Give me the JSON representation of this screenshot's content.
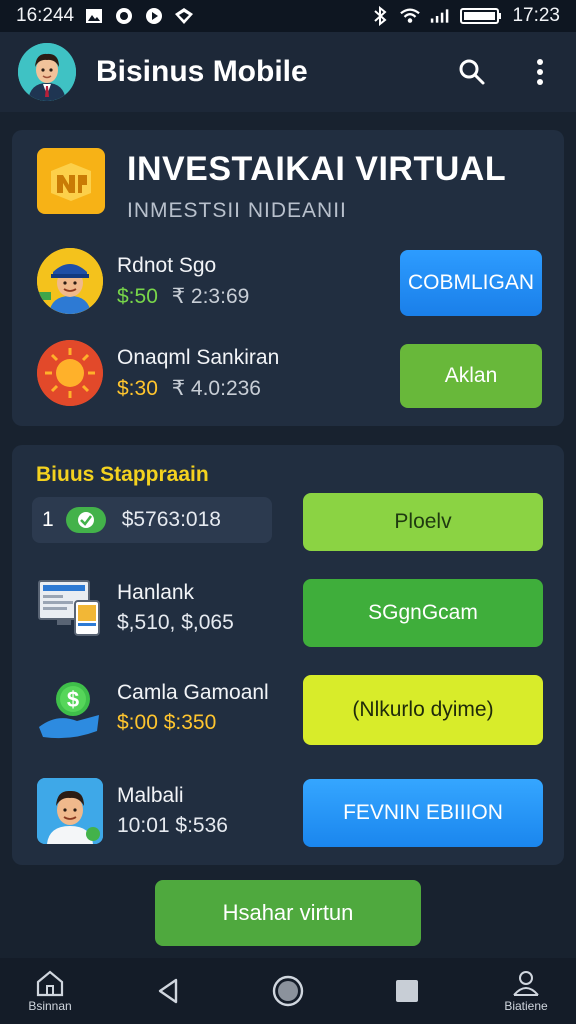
{
  "status_bar": {
    "time_left": "16:244",
    "time_right": "17:23",
    "icons": [
      "image-icon",
      "sync-icon",
      "play-icon",
      "shield-icon",
      "bluetooth-icon",
      "wifi-icon",
      "signal-icon",
      "battery-icon"
    ]
  },
  "app_bar": {
    "title": "Bisinus Mobile",
    "icons": [
      "search-icon",
      "more-vert-icon"
    ]
  },
  "invest_card": {
    "title": "INVESTAIKAI VIRTUAL",
    "subtitle": "INMESTSII NIDEANII",
    "rows": [
      {
        "name": "Rdnot Sgo",
        "value": "$:50",
        "extra": "₹ 2:3:69",
        "button": "COBMLIGAN"
      },
      {
        "name": "Onaqml Sankiran",
        "value": "$:30",
        "extra": "₹ 4.0:236",
        "button": "Aklan"
      }
    ]
  },
  "list_card": {
    "section_title": "Biuus Stappraain",
    "balance": {
      "index": "1",
      "value": "$5763:018"
    },
    "balance_button": "Ploelv",
    "rows": [
      {
        "name": "Hanlank",
        "values": "$,510, $,065",
        "button": "SGgnGcam"
      },
      {
        "name": "Camla Gamoanl",
        "values": "$:00  $:350",
        "button": "(Nlkurlo dyime)"
      },
      {
        "name": "Malbali",
        "values": "10:01 $:536",
        "button": "FEVNIN EBIIION"
      }
    ]
  },
  "bottom_cta": "Hsahar virtun",
  "nav": {
    "home_label": "Bsinnan",
    "profile_label": "Biatiene"
  },
  "colors": {
    "background": "#18222f",
    "card": "#212e40",
    "accent_yellow": "#f4d21f",
    "accent_blue": "#1a7fe9",
    "accent_green": "#68b83a"
  }
}
